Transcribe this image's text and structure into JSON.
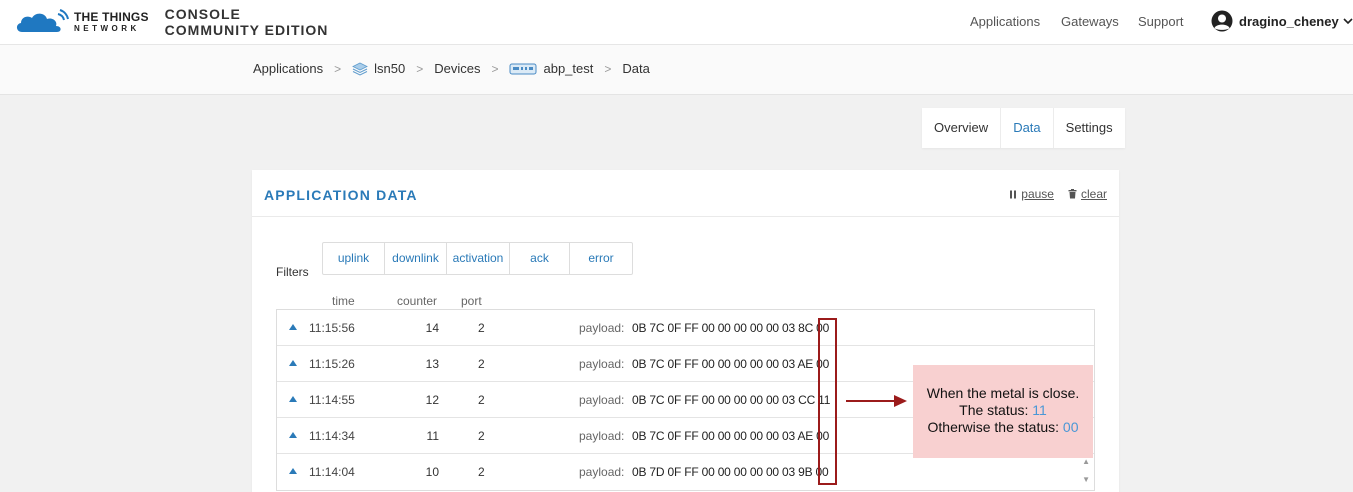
{
  "brand": {
    "ttn_line1": "THE THINGS",
    "ttn_line2": "NETWORK",
    "console_line1": "CONSOLE",
    "console_line2": "COMMUNITY EDITION"
  },
  "topnav": {
    "applications": "Applications",
    "gateways": "Gateways",
    "support": "Support",
    "user": "dragino_cheney"
  },
  "breadcrumb": {
    "applications": "Applications",
    "app": "lsn50",
    "devices": "Devices",
    "device": "abp_test",
    "current": "Data"
  },
  "tabs": [
    "Overview",
    "Data",
    "Settings"
  ],
  "panel": {
    "title": "APPLICATION DATA",
    "pause": "pause",
    "clear": "clear"
  },
  "filters": {
    "label": "Filters",
    "items": [
      "uplink",
      "downlink",
      "activation",
      "ack",
      "error"
    ]
  },
  "columns": {
    "time": "time",
    "counter": "counter",
    "port": "port"
  },
  "payload_label": "payload:",
  "rows": [
    {
      "time": "11:15:56",
      "counter": "14",
      "port": "2",
      "payload": "0B 7C 0F FF 00 00 00 00 00 03 8C 00"
    },
    {
      "time": "11:15:26",
      "counter": "13",
      "port": "2",
      "payload": "0B 7C 0F FF 00 00 00 00 00 03 AE 00"
    },
    {
      "time": "11:14:55",
      "counter": "12",
      "port": "2",
      "payload": "0B 7C 0F FF 00 00 00 00 00 03 CC 11"
    },
    {
      "time": "11:14:34",
      "counter": "11",
      "port": "2",
      "payload": "0B 7C 0F FF 00 00 00 00 00 03 AE 00"
    },
    {
      "time": "11:14:04",
      "counter": "10",
      "port": "2",
      "payload": "0B 7D 0F FF 00 00 00 00 00 03 9B 00"
    }
  ],
  "note": {
    "line1": "When the metal is close.",
    "line2_prefix": "The status:",
    "line2_value": "11",
    "line3_prefix": "Otherwise the status:",
    "line3_value": "00"
  },
  "colors": {
    "accent": "#2a7ab8",
    "annotation_border": "#9b1b1b",
    "note_bg": "#f8d0d0",
    "note_value": "#4a97d6"
  },
  "icons": {
    "logo": "ttn-cloud-logo",
    "user": "user-avatar-icon",
    "app": "layers-icon",
    "device": "device-icon",
    "pause": "pause-icon",
    "clear": "trash-icon",
    "row": "caret-up-icon"
  }
}
